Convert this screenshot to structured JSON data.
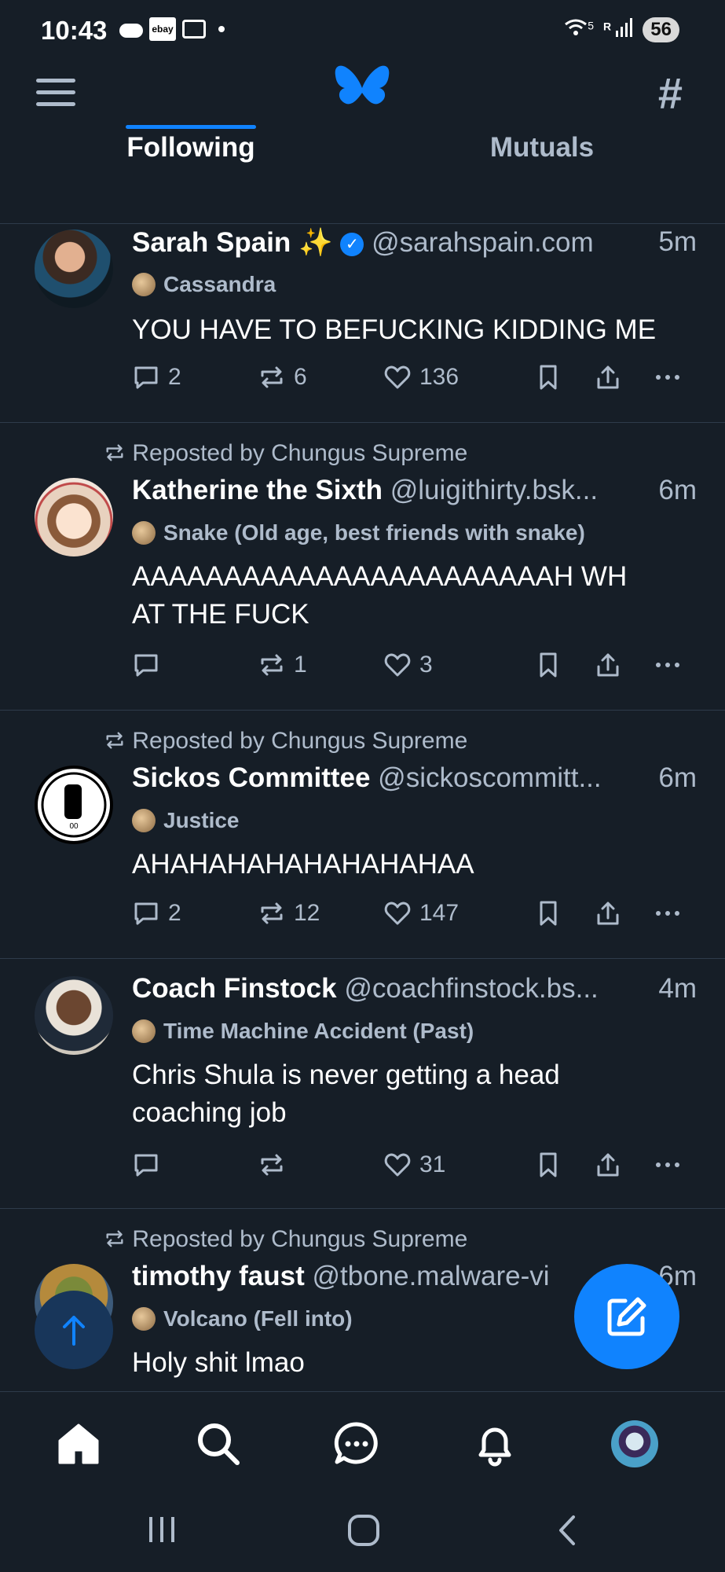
{
  "status_bar": {
    "time": "10:43",
    "ebay_label": "ebay",
    "network_label": "5",
    "signal_label": "R",
    "battery": "56"
  },
  "header": {
    "menu_icon": "hamburger-menu-icon",
    "logo_icon": "butterfly-logo-icon",
    "feeds_icon": "hash-icon",
    "tabs": [
      {
        "label": "Following",
        "active": true
      },
      {
        "label": "Mutuals",
        "active": false
      }
    ]
  },
  "feed": {
    "posts": [
      {
        "repost_by": "",
        "name": "Sarah Spain ✨",
        "verified": true,
        "handle": "@sarahspain.com",
        "time": "5m",
        "label": "Cassandra",
        "text": "YOU HAVE TO BEFUCKING KIDDING ME",
        "replies": "2",
        "reposts": "6",
        "likes": "136"
      },
      {
        "repost_by": "Reposted by Chungus Supreme",
        "name": "Katherine the Sixth",
        "verified": false,
        "handle": "@luigithirty.bsk...",
        "time": "6m",
        "label": "Snake (Old age, best friends with snake)",
        "text": "AAAAAAAAAAAAAAAAAAAAAAAH WHAT THE FUCK",
        "replies": "",
        "reposts": "1",
        "likes": "3"
      },
      {
        "repost_by": "Reposted by Chungus Supreme",
        "name": "Sickos Committee",
        "verified": false,
        "handle": "@sickoscommitt...",
        "time": "6m",
        "label": "Justice",
        "text": "AHAHAHAHAHAHAHAHAA",
        "replies": "2",
        "reposts": "12",
        "likes": "147"
      },
      {
        "repost_by": "",
        "name": "Coach Finstock",
        "verified": false,
        "handle": "@coachfinstock.bs...",
        "time": "4m",
        "label": "Time Machine Accident (Past)",
        "text": "Chris Shula is never getting a head coaching job",
        "replies": "",
        "reposts": "",
        "likes": "31"
      },
      {
        "repost_by": "Reposted by Chungus Supreme",
        "name": "timothy faust",
        "verified": false,
        "handle": "@tbone.malware-vi",
        "time": "6m",
        "label": "Volcano (Fell into)",
        "text": "Holy shit lmao",
        "replies": "",
        "reposts": "",
        "likes": ""
      }
    ]
  },
  "fab_icon": "compose-icon",
  "scroll_top_icon": "arrow-up-icon",
  "bottom_nav": [
    "home-icon",
    "search-icon",
    "chat-icon",
    "bell-icon",
    "profile-avatar"
  ],
  "colors": {
    "background": "#161e27",
    "accent": "#1083fe",
    "muted_text": "#aebbcb",
    "divider": "#2e3b4a"
  }
}
